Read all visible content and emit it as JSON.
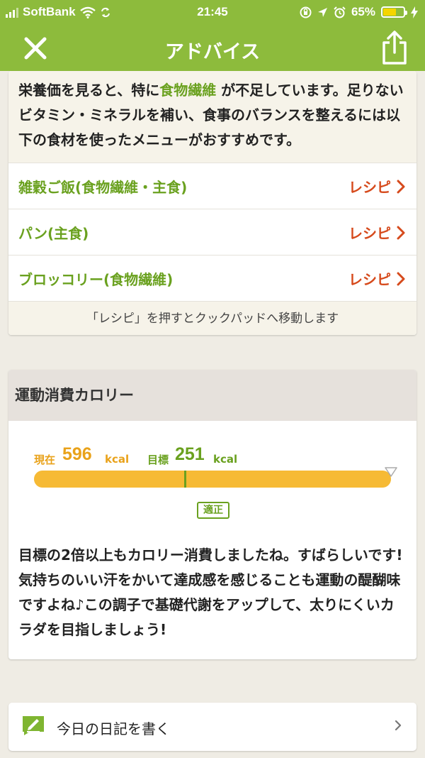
{
  "status_bar": {
    "carrier": "SoftBank",
    "time": "21:45",
    "battery_percent": "65%",
    "battery_level": 0.65,
    "icons": [
      "signal-icon",
      "wifi-icon",
      "sync-icon",
      "rotation-lock-icon",
      "location-icon",
      "alarm-icon",
      "battery-icon",
      "charging-icon"
    ]
  },
  "nav": {
    "title": "アドバイス",
    "close_icon": "close-icon",
    "share_icon": "share-icon"
  },
  "advice": {
    "intro_before": "栄養価を見ると、特に",
    "intro_highlight": "食物繊維",
    "intro_after": " が不足しています。足りないビタミン・ミネラルを補い、食事のバランスを整えるには以下の食材を使ったメニューがおすすめです。",
    "recipes": [
      {
        "name": "雑穀ご飯(食物繊維・主食)",
        "link": "レシピ"
      },
      {
        "name": "パン(主食)",
        "link": "レシピ"
      },
      {
        "name": "ブロッコリー(食物繊維)",
        "link": "レシピ"
      }
    ],
    "note": "「レシピ」を押すとクックパッドへ移動します"
  },
  "calorie": {
    "title": "運動消費カロリー",
    "current_label": "現在",
    "current_value": "596",
    "target_label": "目標",
    "target_value": "251",
    "unit": "kcal",
    "current_fraction": 1.0,
    "target_fraction": 0.42,
    "badge": "適正",
    "message": "目標の2倍以上もカロリー消費しましたね。すばらしいです!\n気持ちのいい汗をかいて達成感を感じることも運動の醍醐味ですよね♪この調子で基礎代謝をアップして、太りにくいカラダを目指しましょう!",
    "colors": {
      "current": "#e9a21a",
      "target": "#6aa11f",
      "bar": "#f6ba35"
    }
  },
  "diary": {
    "label": "今日の日記を書く",
    "icon": "pencil-note-icon"
  },
  "colors": {
    "accent": "#8dbb3c",
    "link_red": "#d64a1c",
    "highlight_green": "#6aa11f"
  }
}
